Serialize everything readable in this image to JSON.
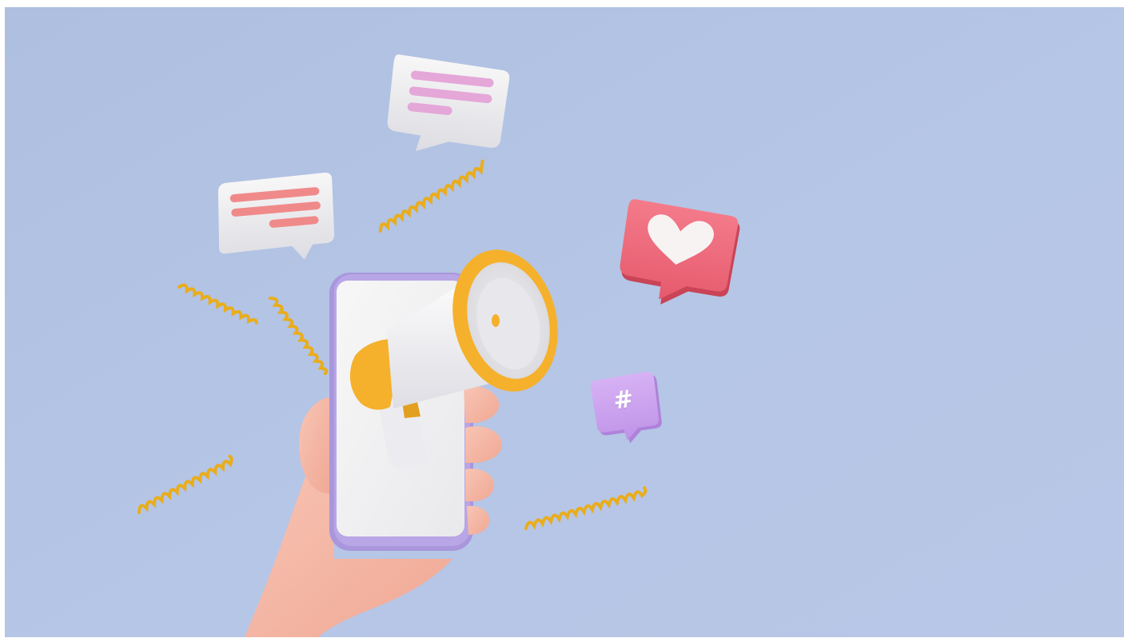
{
  "scene": {
    "kind": "3d-illustration",
    "subject": "hand-holding-phone-with-megaphone",
    "background_color": "#b2c3e2",
    "elements": [
      {
        "icon": "hand-icon",
        "color": "#f4b8a6"
      },
      {
        "icon": "smartphone-icon",
        "frame_color": "#a996dc",
        "screen_color": "#f2f2f2"
      },
      {
        "icon": "megaphone-icon",
        "rim_color": "#f5b12c",
        "body_color": "#f7f7f7"
      },
      {
        "icon": "chat-bubble-icon",
        "text_line_color": "#e4a7d8"
      },
      {
        "icon": "chat-bubble-icon",
        "text_line_color": "#f08a8a"
      },
      {
        "icon": "heart-notification-icon",
        "color": "#f16a7b"
      },
      {
        "icon": "hashtag-bubble-icon",
        "color": "#cda5ef",
        "glyph": "#"
      },
      {
        "icon": "coil-spring-icon",
        "color": "#e9ad1c"
      }
    ]
  },
  "hashtag_badge": {
    "symbol": "#"
  }
}
